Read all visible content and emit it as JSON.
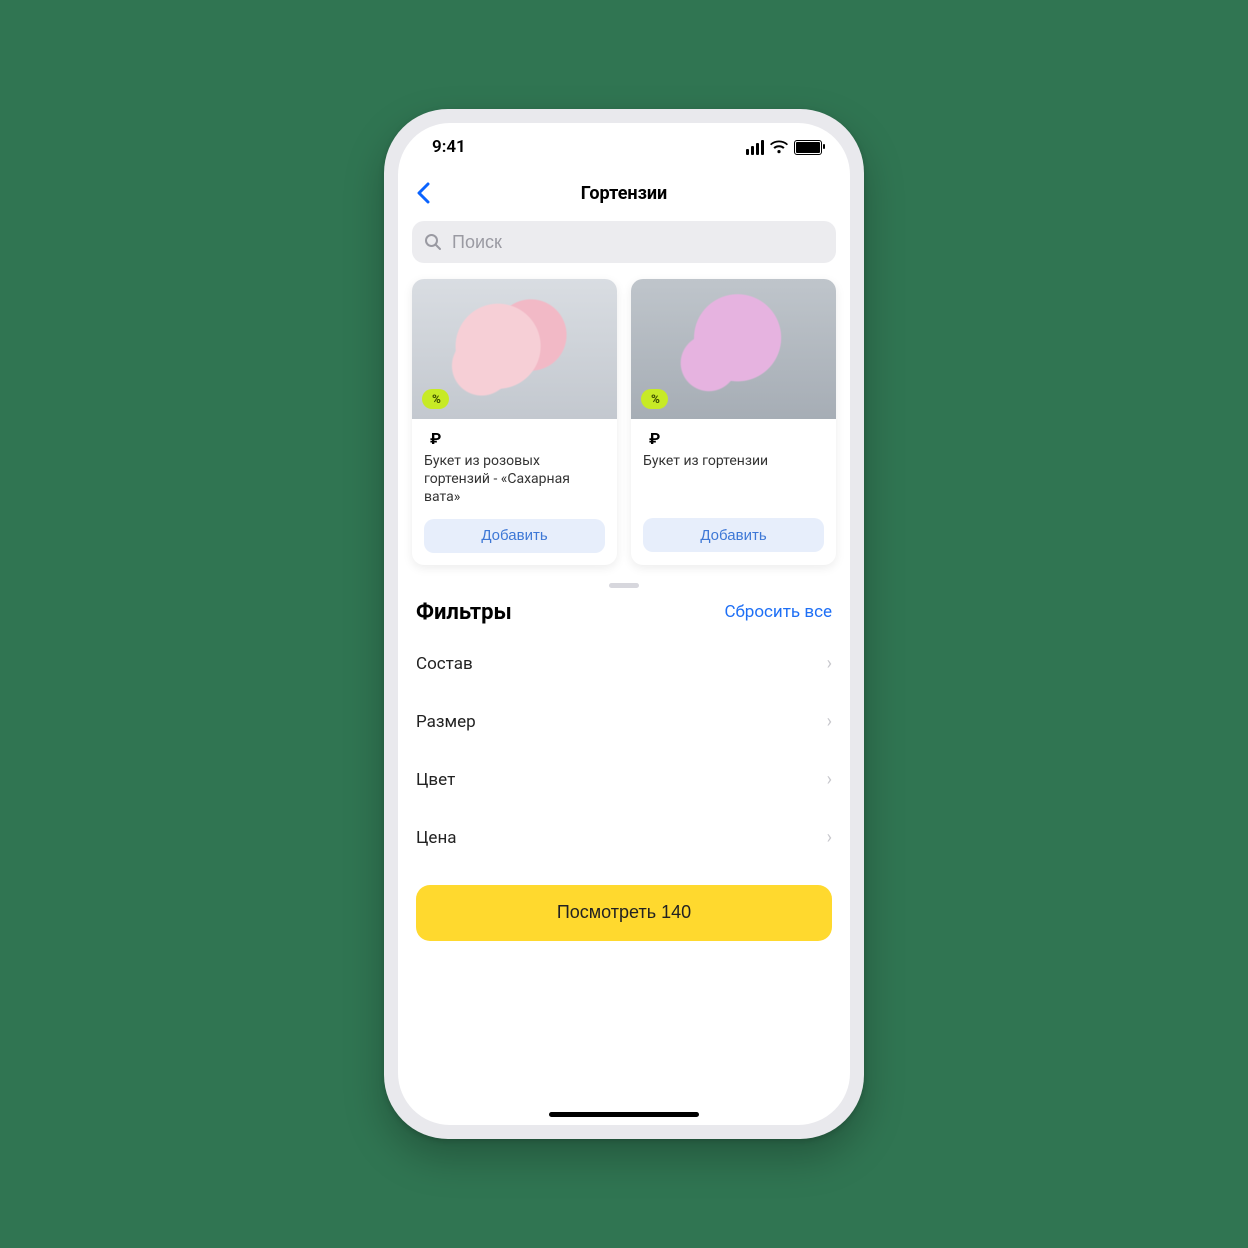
{
  "status": {
    "time": "9:41"
  },
  "header": {
    "title": "Гортензии"
  },
  "search": {
    "placeholder": "Поиск"
  },
  "products": [
    {
      "discount_value": "",
      "discount_suffix": "%",
      "price_value": "",
      "currency": "₽",
      "name": "Букет из розовых гортензий - «Сахарная вата»",
      "add_label": "Добавить"
    },
    {
      "discount_value": "",
      "discount_suffix": "%",
      "price_value": "",
      "currency": "₽",
      "name": "Букет из гортензии",
      "add_label": "Добавить"
    }
  ],
  "filters": {
    "title": "Фильтры",
    "reset_label": "Сбросить все",
    "items": [
      "Состав",
      "Размер",
      "Цвет",
      "Цена"
    ]
  },
  "cta": {
    "label": "Посмотреть 140"
  }
}
